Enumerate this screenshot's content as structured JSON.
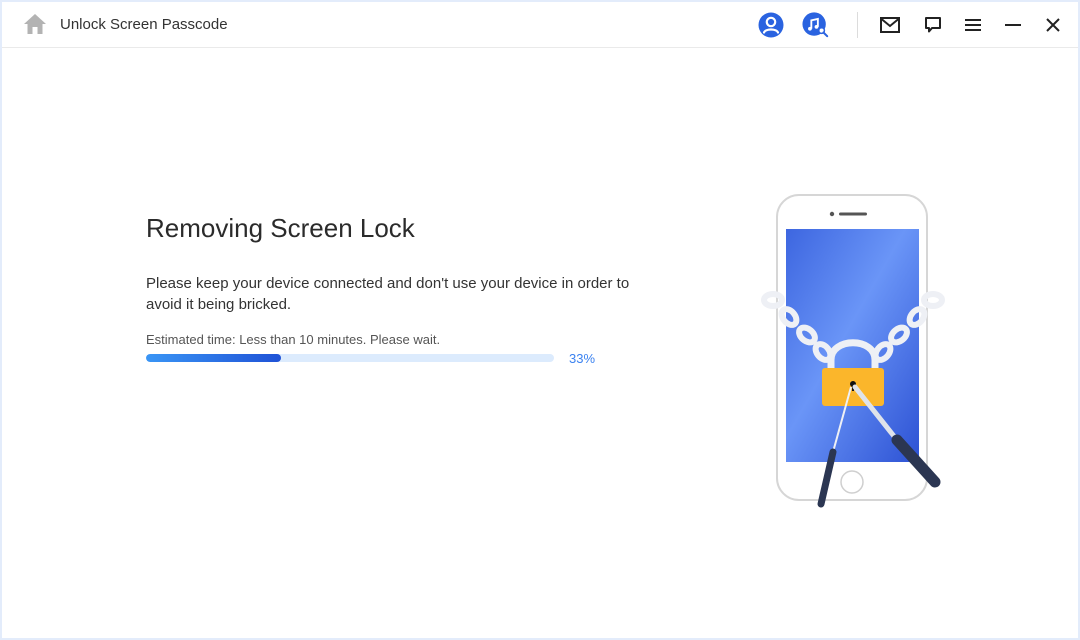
{
  "titlebar": {
    "title": "Unlock Screen Passcode",
    "icons": {
      "home": "home-icon",
      "account": "account-icon",
      "music_search": "music-search-icon",
      "mail": "mail-icon",
      "feedback": "feedback-icon",
      "menu": "menu-icon",
      "minimize": "minimize-icon",
      "close": "close-icon"
    }
  },
  "main": {
    "heading": "Removing Screen Lock",
    "description": "Please keep your device connected and don't use your device in order to avoid it being bricked.",
    "estimate": "Estimated time: Less than 10 minutes. Please wait.",
    "progress": {
      "value": 33,
      "label": "33%"
    }
  },
  "colors": {
    "accent": "#2f6be6",
    "progress_track": "#dcebfd",
    "lock": "#fbb62b",
    "screen": "#4c7ef0"
  }
}
